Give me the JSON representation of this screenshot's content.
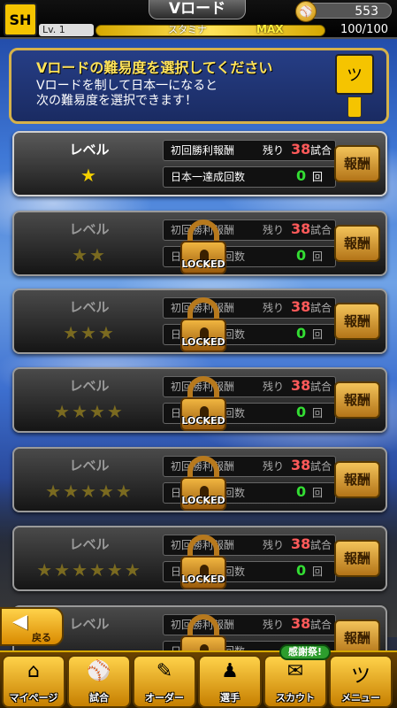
{
  "header": {
    "logo": "SH",
    "title": "Vロード",
    "coins": "553",
    "level": "Lv. 1",
    "stamina_label": "スタミナ",
    "stamina_max": "MAX",
    "stamina_value": "100/100"
  },
  "info": {
    "heading": "Vロードの難易度を選択してください",
    "line1": "Vロードを制して日本一になると",
    "line2": "次の難易度を選択できます！",
    "mascot": "ツ"
  },
  "level_label": "レベル",
  "row1_label": "初回勝利報酬",
  "remaining_label": "残り",
  "games_unit": "試合",
  "row2_label": "日本一達成回数",
  "count_unit": "回",
  "reward_label": "報酬",
  "locked_label": "LOCKED",
  "levels": [
    {
      "stars": "★",
      "remaining": "38",
      "count": "0",
      "locked": false
    },
    {
      "stars": "★★",
      "remaining": "38",
      "count": "0",
      "locked": true
    },
    {
      "stars": "★★★",
      "remaining": "38",
      "count": "0",
      "locked": true
    },
    {
      "stars": "★★★★",
      "remaining": "38",
      "count": "0",
      "locked": true
    },
    {
      "stars": "★★★★★",
      "remaining": "38",
      "count": "0",
      "locked": true
    },
    {
      "stars": "★★★★★★",
      "remaining": "38",
      "count": "0",
      "locked": true
    },
    {
      "stars": "",
      "remaining": "38",
      "count": "",
      "locked": true
    }
  ],
  "back_label": "戻る",
  "nav": [
    {
      "label": "マイページ",
      "icon": "⌂"
    },
    {
      "label": "試合",
      "icon": "⚾"
    },
    {
      "label": "オーダー",
      "icon": "✎"
    },
    {
      "label": "選手",
      "icon": "♟"
    },
    {
      "label": "スカウト",
      "icon": "✉"
    },
    {
      "label": "メニュー",
      "icon": "ツ"
    }
  ],
  "badge": "感謝祭!"
}
